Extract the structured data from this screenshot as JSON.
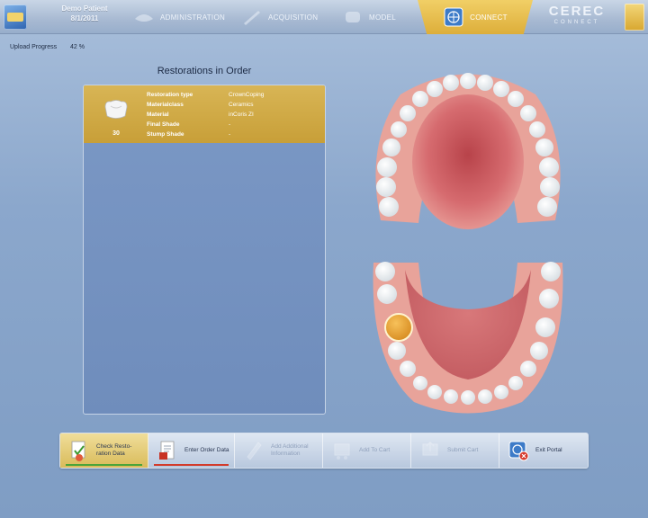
{
  "header": {
    "patient_name": "Demo Patient",
    "patient_date": "8/1/2011",
    "steps": {
      "administration": "ADMINISTRATION",
      "acquisition": "ACQUISITION",
      "model": "MODEL",
      "connect": "CONNECT"
    },
    "brand": "CEREC",
    "brand_sub": "CONNECT"
  },
  "upload": {
    "label": "Upload Progress",
    "value": "42 %"
  },
  "panel": {
    "title": "Restorations in Order",
    "restorations": [
      {
        "tooth_number": "30",
        "properties": [
          {
            "key": "Restoration type",
            "value": "CrownCoping"
          },
          {
            "key": "Materialclass",
            "value": "Ceramics"
          },
          {
            "key": "Material",
            "value": "inCoris ZI"
          },
          {
            "key": "Final Shade",
            "value": "-"
          },
          {
            "key": "Stump Shade",
            "value": "-"
          }
        ]
      }
    ]
  },
  "toolbar": {
    "check_line1": "Check Resto-",
    "check_line2": "ration Data",
    "order": "Enter Order Data",
    "additional_line1": "Add Additional",
    "additional_line2": "Information",
    "cart": "Add To Cart",
    "submit": "Submit Cart",
    "exit": "Exit Portal"
  },
  "colors": {
    "accent_gold": "#ddae3a",
    "selected_tooth": "#e7a23a",
    "panel_blue": "#7391bf"
  }
}
